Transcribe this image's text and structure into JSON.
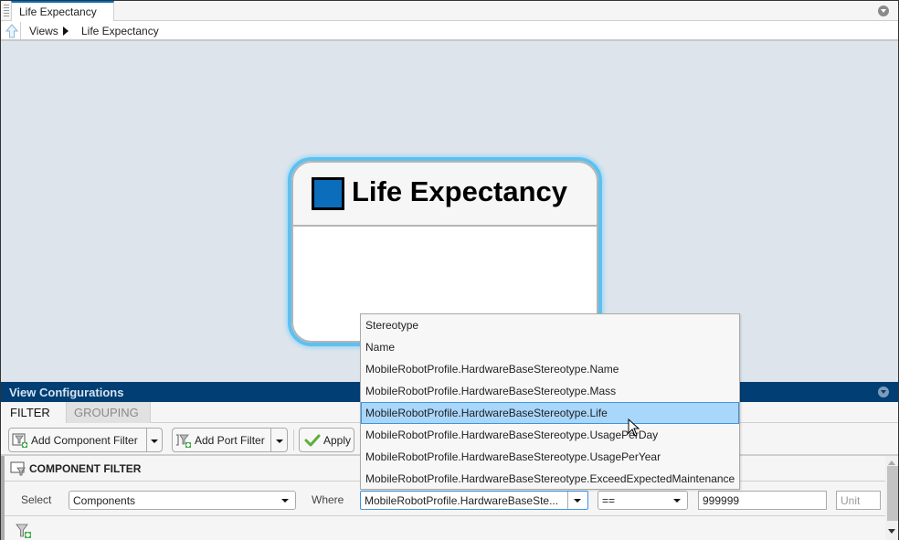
{
  "window": {
    "tab_title": "Life Expectancy"
  },
  "breadcrumb": {
    "items": [
      "Views",
      "Life Expectancy"
    ]
  },
  "canvas": {
    "view_title": "Life Expectancy",
    "view_color": "#0a6ebd"
  },
  "view_config": {
    "title": "View Configurations",
    "tabs": [
      {
        "label": "FILTER",
        "active": true
      },
      {
        "label": "GROUPING",
        "active": false
      }
    ],
    "toolbar": {
      "add_component_filter": "Add Component Filter",
      "add_port_filter": "Add Port Filter",
      "apply": "Apply"
    },
    "component_filter": {
      "title": "COMPONENT FILTER",
      "select_label": "Select",
      "select_value": "Components",
      "where_label": "Where",
      "where_value": "MobileRobotProfile.HardwareBaseSte...",
      "operator_value": "==",
      "value": "999999",
      "unit_placeholder": "Unit"
    }
  },
  "dropdown": {
    "options": [
      "Stereotype",
      "Name",
      "MobileRobotProfile.HardwareBaseStereotype.Name",
      "MobileRobotProfile.HardwareBaseStereotype.Mass",
      "MobileRobotProfile.HardwareBaseStereotype.Life",
      "MobileRobotProfile.HardwareBaseStereotype.UsagePerDay",
      "MobileRobotProfile.HardwareBaseStereotype.UsagePerYear",
      "MobileRobotProfile.HardwareBaseStereotype.ExceedExpectedMaintenance"
    ],
    "selected_index": 4
  }
}
